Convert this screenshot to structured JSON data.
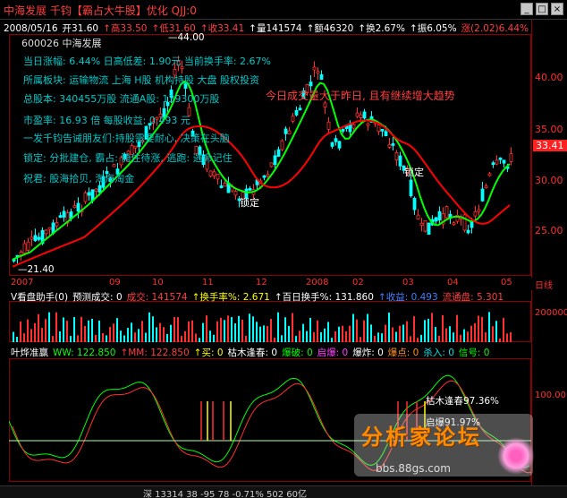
{
  "title_bar": {
    "title": "中海发展  千钧【霸占大牛股】优化 QJJ:0"
  },
  "info_bar": [
    {
      "text": "2008/05/16",
      "color": "wht"
    },
    {
      "text": "开31.60",
      "color": "wht"
    },
    {
      "text": "↑高33.50",
      "color": "red"
    },
    {
      "text": "↑低31.60",
      "color": "red"
    },
    {
      "text": "↑收33.41",
      "color": "red"
    },
    {
      "text": "↑量141574",
      "color": "wht"
    },
    {
      "text": "↑额46320",
      "color": "wht"
    },
    {
      "text": "↑换2.67%",
      "color": "wht"
    },
    {
      "text": "↑振6.05%",
      "color": "wht"
    },
    {
      "text": "涨(2.02)6.44%",
      "color": "red"
    }
  ],
  "stock_code": "600026  中海发展",
  "annotations": [
    "当日涨幅: 6.44%    日高低差: 1.90元    当前换手率: 2.67%",
    "所属板块: 运输物流 上海 H股 机构持股 大盘 股权投资",
    "总股本: 340455万股  流通A股: 139300万股",
    "市盈率: 16.93 倍    每股收益: 0.493 元",
    "一发千钧告诫朋友们:持股需要耐心, 决策在头脑",
    "锁定: 分批建仓, 霸占: 骑住待涨, 逃跑: 逃命记住",
    "祝君: 股海拾贝, 淘海淘金"
  ],
  "chart_labels": {
    "high_marker": "44.00",
    "low_marker": "21.40",
    "lock1": "锁定",
    "lock2": "锁定",
    "volume_note": "今日成交量大于昨日, 且有继续增大趋势",
    "current_price": "33.41",
    "lock_box": "锁定"
  },
  "price_axis": [
    "40.00",
    "35.00",
    "30.00",
    "25.00"
  ],
  "date_axis": [
    "2007",
    "09",
    "10",
    "11",
    "12",
    "2008",
    "02",
    "03",
    "04",
    "05",
    "日线"
  ],
  "volume_header": [
    {
      "text": "V看盘助手(0)",
      "color": "wht"
    },
    {
      "text": "预测成交: 0",
      "color": "wht"
    },
    {
      "text": "成交: 141574",
      "color": "red"
    },
    {
      "text": "↑换手率%: 2.671",
      "color": "yel"
    },
    {
      "text": "↑百日换手%: 131.860",
      "color": "wht"
    },
    {
      "text": "↑收益: 0.493",
      "color": "blu"
    },
    {
      "text": "流通盘: 5.301",
      "color": "red"
    }
  ],
  "volume_axis": "200000",
  "indicator_header": [
    {
      "text": "叶烨准赢",
      "color": "wht"
    },
    {
      "text": "WW: 122.850",
      "color": "grn"
    },
    {
      "text": "↑MM: 122.850",
      "color": "red"
    },
    {
      "text": "↑买: 0",
      "color": "yel"
    },
    {
      "text": "枯木逢春: 0",
      "color": "wht"
    },
    {
      "text": "爆破: 0",
      "color": "grn"
    },
    {
      "text": "启爆: 0",
      "color": "mag"
    },
    {
      "text": "爆炸: 0",
      "color": "wht"
    },
    {
      "text": "爆点: 0",
      "color": "org"
    },
    {
      "text": "杀入: 0",
      "color": "cyn"
    },
    {
      "text": "信号: 0",
      "color": "grn"
    }
  ],
  "indicator_axis": "100.00",
  "indicator_labels": {
    "kumu": "枯木逢春97.36%",
    "qibao": "启爆91.97%"
  },
  "status_bar": "深  13314  38  -95  78  -0.71%  502  60亿",
  "watermark": {
    "title": "分析家论坛",
    "url": "bbs.88gs.com"
  },
  "colors": {
    "up": "#ff3030",
    "down": "#00ffff",
    "ma_short": "#00ff00",
    "ma_long": "#ff0000",
    "frame": "#8b0000"
  }
}
